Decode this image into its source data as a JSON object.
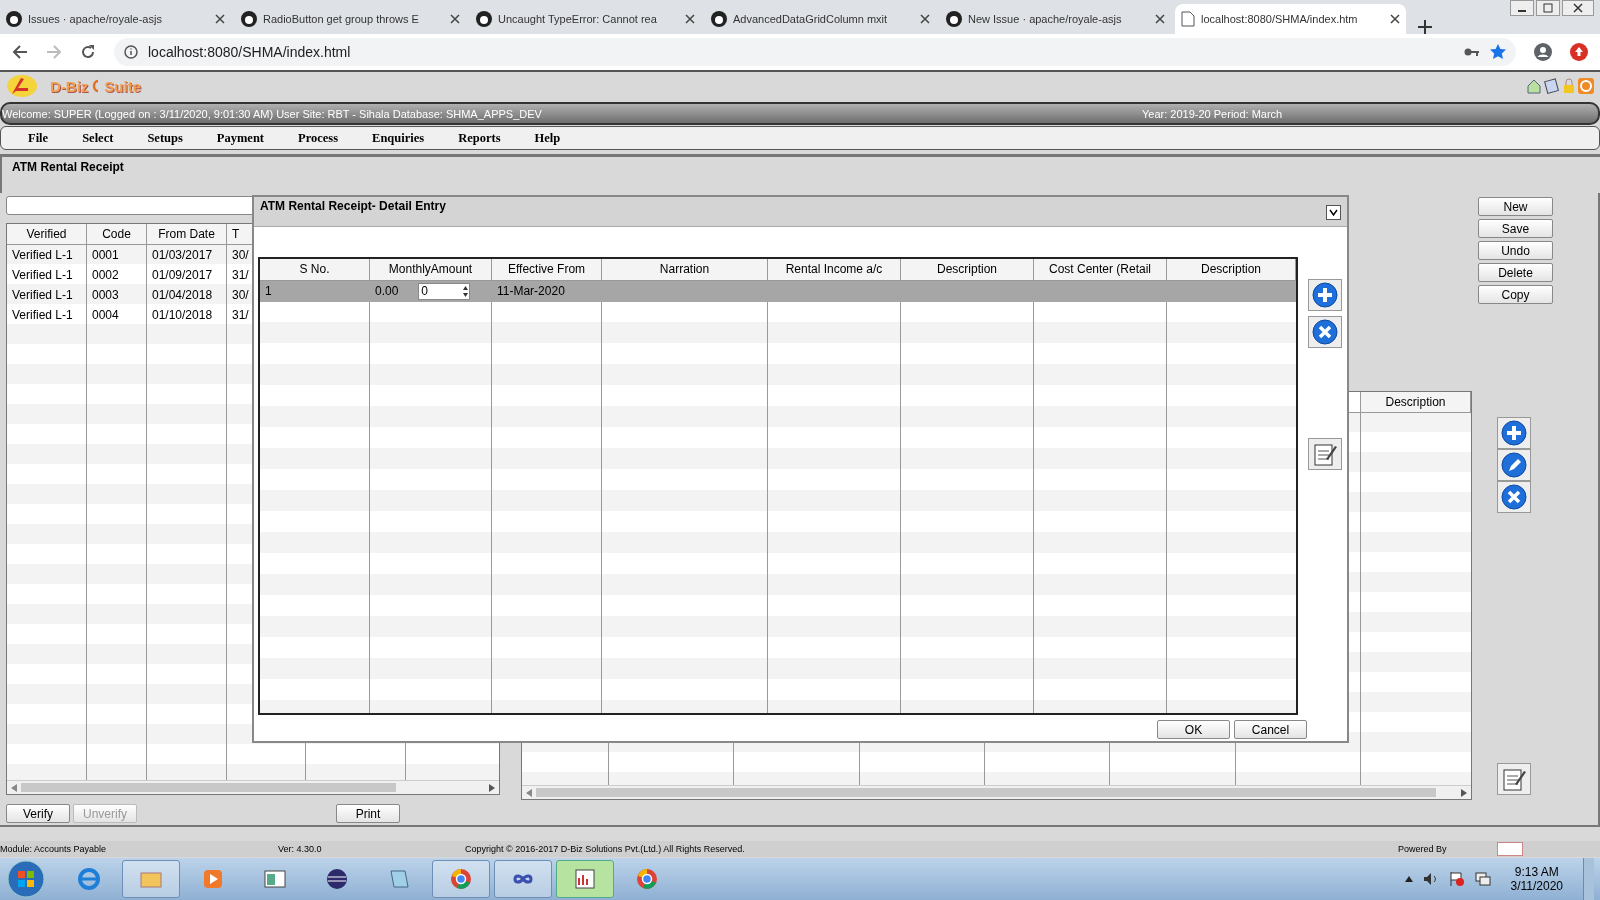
{
  "browser": {
    "tabs": [
      {
        "title": "Issues · apache/royale-asjs",
        "selected": false
      },
      {
        "title": "RadioButton get group throws E",
        "selected": false
      },
      {
        "title": "Uncaught TypeError: Cannot rea",
        "selected": false
      },
      {
        "title": "AdvancedDataGridColumn mxit",
        "selected": false
      },
      {
        "title": "New Issue · apache/royale-asjs",
        "selected": false
      },
      {
        "title": "localhost:8080/SHMA/index.htm",
        "selected": true
      }
    ],
    "address": "localhost:8080/SHMA/index.html"
  },
  "app": {
    "brand": [
      "D-Biz",
      "Suite"
    ],
    "welcome": "Welcome: SUPER (Logged on : 3/11/2020, 9:01:30 AM) User Site: RBT - Sihala Database: SHMA_APPS_DEV",
    "period": "Year: 2019-20 Period: March",
    "menu": [
      "File",
      "Select",
      "Setups",
      "Payment",
      "Process",
      "Enquiries",
      "Reports",
      "Help"
    ],
    "page_title": "ATM Rental Receipt"
  },
  "left_grid": {
    "columns": [
      "Verified",
      "Code",
      "From Date",
      "T"
    ],
    "rows": [
      [
        "Verified L-1",
        "0001",
        "01/03/2017",
        "30/"
      ],
      [
        "Verified L-1",
        "0002",
        "01/09/2017",
        "31/"
      ],
      [
        "Verified L-1",
        "0003",
        "01/04/2018",
        "30/"
      ],
      [
        "Verified L-1",
        "0004",
        "01/10/2018",
        "31/"
      ]
    ]
  },
  "bottom_buttons": [
    {
      "label": "Verify",
      "disabled": false
    },
    {
      "label": "Unverify",
      "disabled": true
    },
    {
      "label": "Print",
      "disabled": false
    }
  ],
  "side_buttons": [
    "New",
    "Save",
    "Undo",
    "Delete",
    "Copy"
  ],
  "right_grid": {
    "columns": [
      "Description"
    ]
  },
  "dialog": {
    "title": "ATM Rental Receipt- Detail Entry",
    "columns": [
      "S No.",
      "MonthlyAmount",
      "Effective From",
      "Narration",
      "Rental Income a/c",
      "Description",
      "Cost Center (Retail",
      "Description"
    ],
    "rows": [
      {
        "s_no": "1",
        "monthly_amount": "0.00",
        "amount_input": "0",
        "effective_from": "11-Mar-2020",
        "selected": true
      }
    ],
    "buttons": [
      "OK",
      "Cancel"
    ]
  },
  "status": {
    "module": "Module: Accounts Payable",
    "version": "Ver: 4.30.0",
    "copyright": "Copyright © 2016-2017 D-Biz Solutions Pvt.(Ltd.) All Rights Reserved.",
    "powered_by": "Powered By"
  },
  "taskbar": {
    "time": "9:13 AM",
    "date": "3/11/2020"
  }
}
